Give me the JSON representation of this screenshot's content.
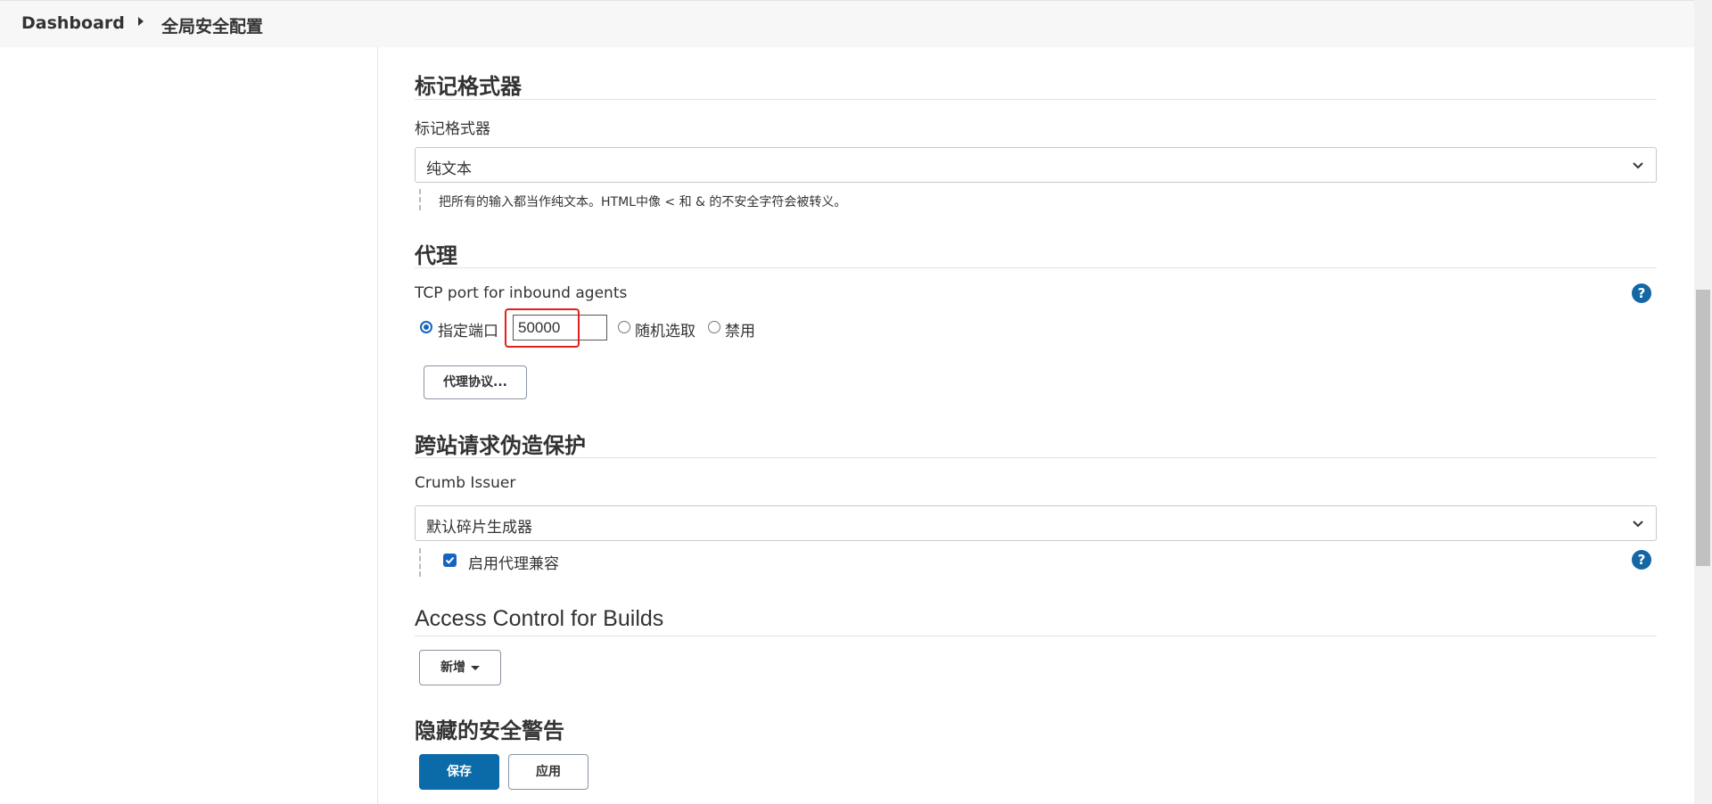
{
  "breadcrumb": {
    "home": "Dashboard",
    "current": "全局安全配置"
  },
  "markup": {
    "heading": "标记格式器",
    "label": "标记格式器",
    "selected": "纯文本",
    "description": "把所有的输入都当作纯文本。HTML中像 < 和 & 的不安全字符会被转义。"
  },
  "agents": {
    "heading": "代理",
    "label": "TCP port for inbound agents",
    "options": {
      "fixed": "指定端口",
      "random": "随机选取",
      "disable": "禁用"
    },
    "port_value": "50000",
    "protocols_button": "代理协议..."
  },
  "csrf": {
    "heading": "跨站请求伪造保护",
    "label": "Crumb Issuer",
    "selected": "默认碎片生成器",
    "proxy_compat_label": "启用代理兼容"
  },
  "builds": {
    "heading": "Access Control for Builds",
    "add_button": "新增"
  },
  "hidden_warnings": {
    "heading": "隐藏的安全警告"
  },
  "actions": {
    "save": "保存",
    "apply": "应用"
  },
  "icons": {
    "help": "?",
    "chevron": "chevron-down-icon"
  },
  "colors": {
    "primary": "#0b6aa8",
    "highlight": "#e0201b",
    "help": "#1466a4"
  }
}
